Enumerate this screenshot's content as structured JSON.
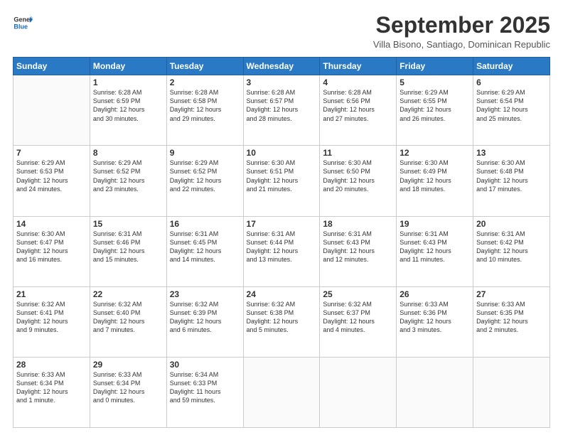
{
  "logo": {
    "line1": "General",
    "line2": "Blue"
  },
  "header": {
    "title": "September 2025",
    "subtitle": "Villa Bisono, Santiago, Dominican Republic"
  },
  "days_of_week": [
    "Sunday",
    "Monday",
    "Tuesday",
    "Wednesday",
    "Thursday",
    "Friday",
    "Saturday"
  ],
  "weeks": [
    [
      {
        "day": "",
        "info": ""
      },
      {
        "day": "1",
        "info": "Sunrise: 6:28 AM\nSunset: 6:59 PM\nDaylight: 12 hours\nand 30 minutes."
      },
      {
        "day": "2",
        "info": "Sunrise: 6:28 AM\nSunset: 6:58 PM\nDaylight: 12 hours\nand 29 minutes."
      },
      {
        "day": "3",
        "info": "Sunrise: 6:28 AM\nSunset: 6:57 PM\nDaylight: 12 hours\nand 28 minutes."
      },
      {
        "day": "4",
        "info": "Sunrise: 6:28 AM\nSunset: 6:56 PM\nDaylight: 12 hours\nand 27 minutes."
      },
      {
        "day": "5",
        "info": "Sunrise: 6:29 AM\nSunset: 6:55 PM\nDaylight: 12 hours\nand 26 minutes."
      },
      {
        "day": "6",
        "info": "Sunrise: 6:29 AM\nSunset: 6:54 PM\nDaylight: 12 hours\nand 25 minutes."
      }
    ],
    [
      {
        "day": "7",
        "info": "Sunrise: 6:29 AM\nSunset: 6:53 PM\nDaylight: 12 hours\nand 24 minutes."
      },
      {
        "day": "8",
        "info": "Sunrise: 6:29 AM\nSunset: 6:52 PM\nDaylight: 12 hours\nand 23 minutes."
      },
      {
        "day": "9",
        "info": "Sunrise: 6:29 AM\nSunset: 6:52 PM\nDaylight: 12 hours\nand 22 minutes."
      },
      {
        "day": "10",
        "info": "Sunrise: 6:30 AM\nSunset: 6:51 PM\nDaylight: 12 hours\nand 21 minutes."
      },
      {
        "day": "11",
        "info": "Sunrise: 6:30 AM\nSunset: 6:50 PM\nDaylight: 12 hours\nand 20 minutes."
      },
      {
        "day": "12",
        "info": "Sunrise: 6:30 AM\nSunset: 6:49 PM\nDaylight: 12 hours\nand 18 minutes."
      },
      {
        "day": "13",
        "info": "Sunrise: 6:30 AM\nSunset: 6:48 PM\nDaylight: 12 hours\nand 17 minutes."
      }
    ],
    [
      {
        "day": "14",
        "info": "Sunrise: 6:30 AM\nSunset: 6:47 PM\nDaylight: 12 hours\nand 16 minutes."
      },
      {
        "day": "15",
        "info": "Sunrise: 6:31 AM\nSunset: 6:46 PM\nDaylight: 12 hours\nand 15 minutes."
      },
      {
        "day": "16",
        "info": "Sunrise: 6:31 AM\nSunset: 6:45 PM\nDaylight: 12 hours\nand 14 minutes."
      },
      {
        "day": "17",
        "info": "Sunrise: 6:31 AM\nSunset: 6:44 PM\nDaylight: 12 hours\nand 13 minutes."
      },
      {
        "day": "18",
        "info": "Sunrise: 6:31 AM\nSunset: 6:43 PM\nDaylight: 12 hours\nand 12 minutes."
      },
      {
        "day": "19",
        "info": "Sunrise: 6:31 AM\nSunset: 6:43 PM\nDaylight: 12 hours\nand 11 minutes."
      },
      {
        "day": "20",
        "info": "Sunrise: 6:31 AM\nSunset: 6:42 PM\nDaylight: 12 hours\nand 10 minutes."
      }
    ],
    [
      {
        "day": "21",
        "info": "Sunrise: 6:32 AM\nSunset: 6:41 PM\nDaylight: 12 hours\nand 9 minutes."
      },
      {
        "day": "22",
        "info": "Sunrise: 6:32 AM\nSunset: 6:40 PM\nDaylight: 12 hours\nand 7 minutes."
      },
      {
        "day": "23",
        "info": "Sunrise: 6:32 AM\nSunset: 6:39 PM\nDaylight: 12 hours\nand 6 minutes."
      },
      {
        "day": "24",
        "info": "Sunrise: 6:32 AM\nSunset: 6:38 PM\nDaylight: 12 hours\nand 5 minutes."
      },
      {
        "day": "25",
        "info": "Sunrise: 6:32 AM\nSunset: 6:37 PM\nDaylight: 12 hours\nand 4 minutes."
      },
      {
        "day": "26",
        "info": "Sunrise: 6:33 AM\nSunset: 6:36 PM\nDaylight: 12 hours\nand 3 minutes."
      },
      {
        "day": "27",
        "info": "Sunrise: 6:33 AM\nSunset: 6:35 PM\nDaylight: 12 hours\nand 2 minutes."
      }
    ],
    [
      {
        "day": "28",
        "info": "Sunrise: 6:33 AM\nSunset: 6:34 PM\nDaylight: 12 hours\nand 1 minute."
      },
      {
        "day": "29",
        "info": "Sunrise: 6:33 AM\nSunset: 6:34 PM\nDaylight: 12 hours\nand 0 minutes."
      },
      {
        "day": "30",
        "info": "Sunrise: 6:34 AM\nSunset: 6:33 PM\nDaylight: 11 hours\nand 59 minutes."
      },
      {
        "day": "",
        "info": ""
      },
      {
        "day": "",
        "info": ""
      },
      {
        "day": "",
        "info": ""
      },
      {
        "day": "",
        "info": ""
      }
    ]
  ]
}
